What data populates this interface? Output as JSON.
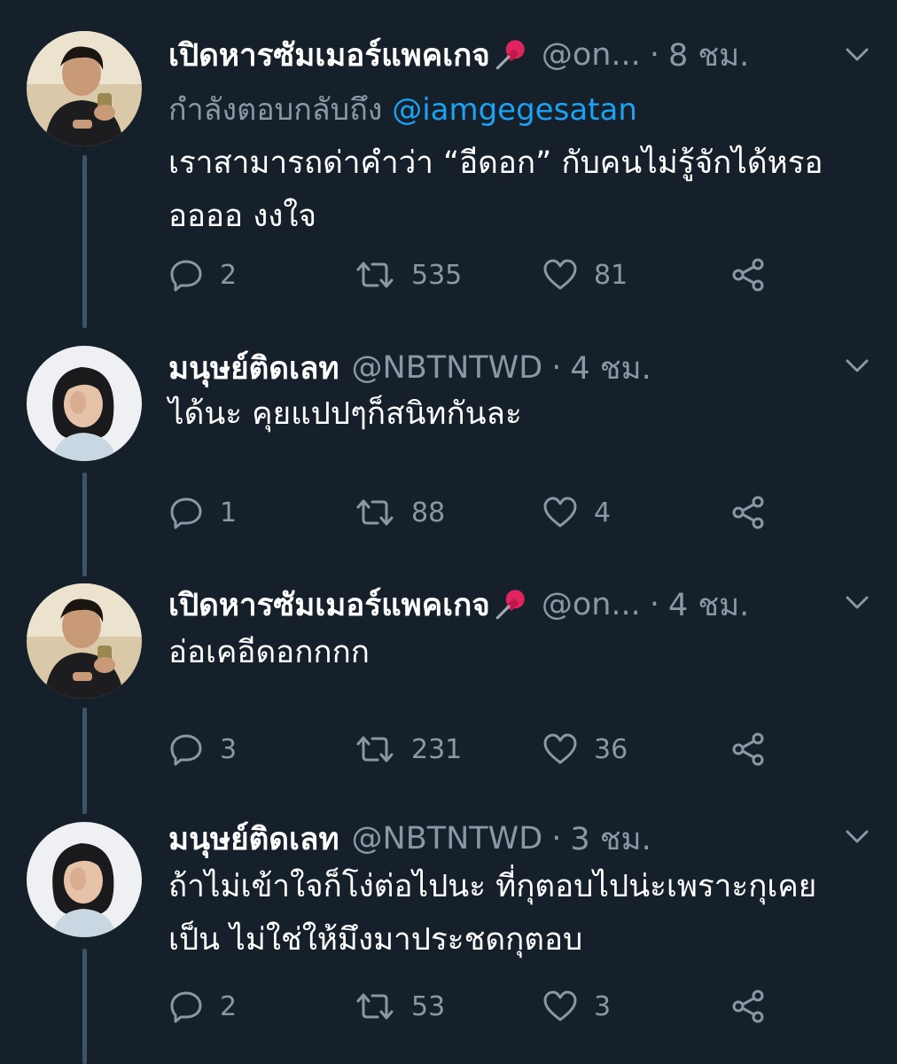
{
  "tweets": [
    {
      "name": "เปิดหารซัมเมอร์แพคเกจ",
      "pin": "📌",
      "handle": "@on...",
      "separator": "·",
      "time": "8 ชม.",
      "reply_prefix": "กำลังตอบกลับถึง ",
      "reply_mention": "@iamgegesatan",
      "text": "เราสามารถด่าคำว่า “อีดอก” กับคนไม่รู้จักได้หรอออออ งงใจ",
      "replies": "2",
      "retweets": "535",
      "likes": "81",
      "avatar": "boy-with-drink"
    },
    {
      "name": "มนุษย์ติดเลท",
      "handle": "@NBTNTWD",
      "separator": "·",
      "time": "4 ชม.",
      "text": "ได้นะ คุยแปปๆก็สนิทกันละ",
      "replies": "1",
      "retweets": "88",
      "likes": "4",
      "avatar": "girl-hand-face"
    },
    {
      "name": "เปิดหารซัมเมอร์แพคเกจ",
      "pin": "📌",
      "handle": "@on...",
      "separator": "·",
      "time": "4 ชม.",
      "text": "อ่อเคอีดอกกกก",
      "replies": "3",
      "retweets": "231",
      "likes": "36",
      "avatar": "boy-with-drink"
    },
    {
      "name": "มนุษย์ติดเลท",
      "handle": "@NBTNTWD",
      "separator": "·",
      "time": "3 ชม.",
      "text": "ถ้าไม่เข้าใจก็โง่ต่อไปนะ ที่กุตอบไปน่ะเพราะกุเคยเป็น ไม่ใช่ให้มึงมาประชดกุตอบ",
      "replies": "2",
      "retweets": "53",
      "likes": "3",
      "avatar": "girl-hand-face"
    }
  ],
  "colors": {
    "background": "#15202b",
    "secondary_text": "#8899a6",
    "link": "#1da1f2",
    "thread_line": "#3d5466"
  },
  "icons": {
    "reply": "reply-icon",
    "retweet": "retweet-icon",
    "like": "heart-icon",
    "share": "share-icon",
    "menu": "chevron-down-icon",
    "pin": "pushpin-icon"
  }
}
